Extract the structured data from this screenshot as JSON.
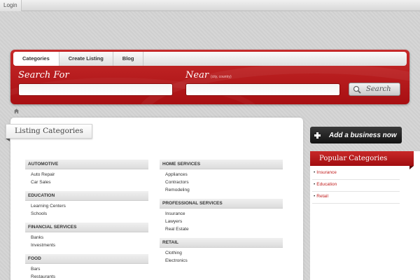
{
  "topbar": {
    "login_label": "Login"
  },
  "nav": {
    "tabs": [
      {
        "label": "Categories"
      },
      {
        "label": "Create Listing"
      },
      {
        "label": "Blog"
      }
    ]
  },
  "search": {
    "search_label": "Search For",
    "near_label": "Near",
    "near_hint": "(city, country)",
    "search_placeholder": "",
    "near_placeholder": "",
    "button_label": "Search"
  },
  "main": {
    "heading": "Listing Categories",
    "left_column": [
      {
        "title": "AUTOMOTIVE",
        "items": [
          "Auto Repair",
          "Car Sales"
        ]
      },
      {
        "title": "EDUCATION",
        "items": [
          "Learning Centers",
          "Schools"
        ]
      },
      {
        "title": "FINANCIAL SERVICES",
        "items": [
          "Banks",
          "Investments"
        ]
      },
      {
        "title": "FOOD",
        "items": [
          "Bars",
          "Restaurants"
        ]
      }
    ],
    "right_column": [
      {
        "title": "HOME SERVICES",
        "items": [
          "Appliances",
          "Contractors",
          "Remodeling"
        ]
      },
      {
        "title": "PROFESSIONAL SERVICES",
        "items": [
          "Insurance",
          "Lawyers",
          "Real Estate"
        ]
      },
      {
        "title": "RETAIL",
        "items": [
          "Clothing",
          "Electronics"
        ]
      }
    ]
  },
  "sidebar": {
    "add_business_label": "Add a business now",
    "popular_title": "Popular Categories",
    "popular_items": [
      "Insurance",
      "Education",
      "Retail"
    ]
  },
  "colors": {
    "brand_red": "#b3161a",
    "link_red": "#c01b1b",
    "panel_grey": "#d3d3d3"
  },
  "icons": [
    "home-icon",
    "search-icon",
    "plus-icon"
  ]
}
